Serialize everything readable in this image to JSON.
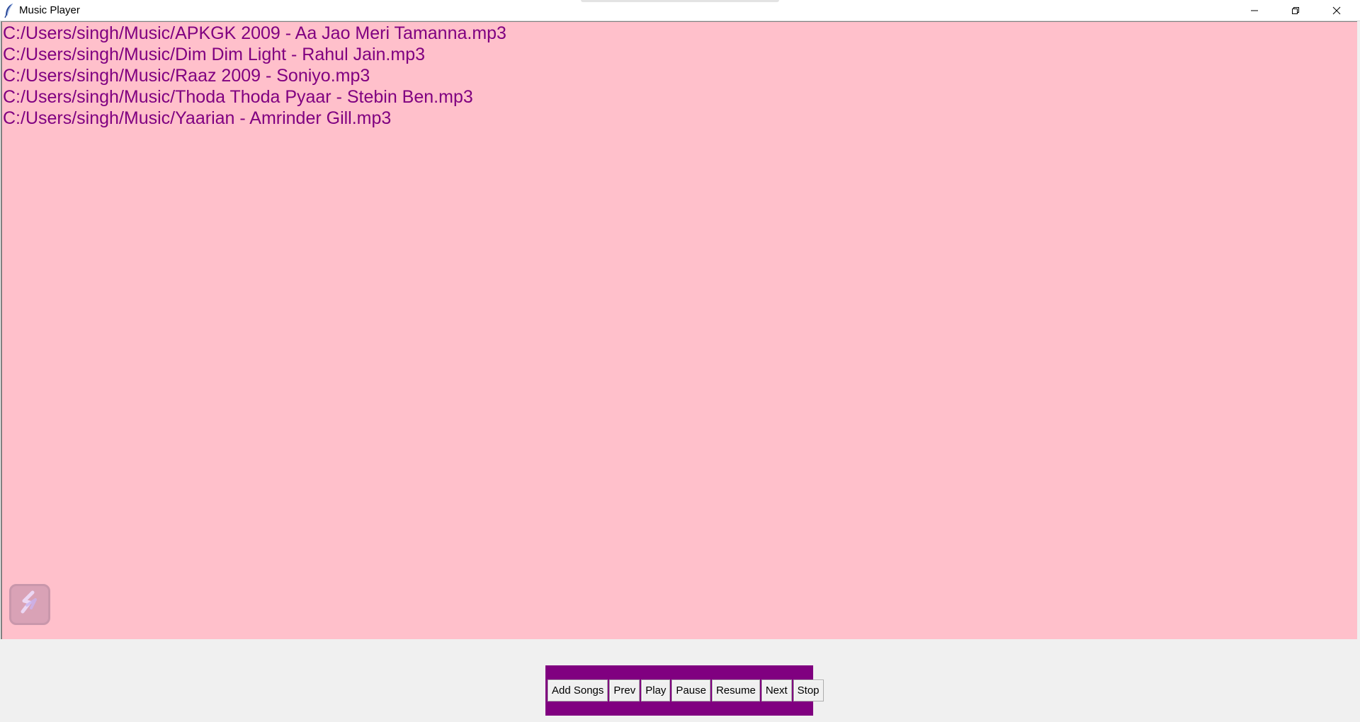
{
  "window": {
    "title": "Music Player",
    "controls": {
      "minimize_icon": "minimize-icon",
      "restore_icon": "restore-icon",
      "close_icon": "close-icon"
    }
  },
  "playlist": {
    "background": "#ffc0cb",
    "text_color": "#800080",
    "songs": [
      "C:/Users/singh/Music/APKGK 2009 - Aa Jao Meri Tamanna.mp3",
      "C:/Users/singh/Music/Dim Dim Light - Rahul Jain.mp3",
      "C:/Users/singh/Music/Raaz 2009 - Soniyo.mp3",
      "C:/Users/singh/Music/Thoda Thoda Pyaar - Stebin Ben.mp3",
      "C:/Users/singh/Music/Yaarian - Amrinder Gill.mp3"
    ]
  },
  "controls": {
    "background": "#800080",
    "buttons": [
      "Add Songs",
      "Prev",
      "Play",
      "Pause",
      "Resume",
      "Next",
      "Stop"
    ]
  },
  "overlay": {
    "icon": "snip-tool-icon"
  }
}
